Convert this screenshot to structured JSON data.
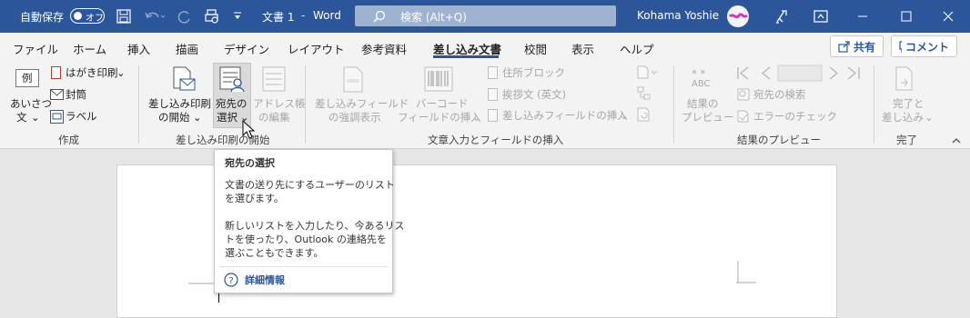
{
  "titlebar": {
    "autosave_label": "自動保存",
    "autosave_state": "オフ",
    "doc_title": "文書 1",
    "dash": "-",
    "app_name": "Word",
    "search_placeholder": "検索 (Alt+Q)",
    "user_name": "Kohama Yoshie"
  },
  "tabs": [
    "ファイル",
    "ホーム",
    "挿入",
    "描画",
    "デザイン",
    "レイアウト",
    "参考資料",
    "差し込み文書",
    "校閲",
    "表示",
    "ヘルプ"
  ],
  "share": {
    "label": "共有"
  },
  "comment": {
    "label": "コメント"
  },
  "ribbon": {
    "create": {
      "greeting_top": "例",
      "greeting_line1": "あいさつ",
      "greeting_line2": "文",
      "postcard": "はがき印刷",
      "envelope": "封筒",
      "label": "ラベル",
      "group": "作成"
    },
    "start": {
      "start_line1": "差し込み印刷",
      "start_line2": "の開始",
      "select_line1": "宛先の",
      "select_line2": "選択",
      "edit_line1": "アドレス帳",
      "edit_line2": "の編集",
      "group": "差し込み印刷の開始"
    },
    "insert": {
      "highlight_line1": "差し込みフィールド",
      "highlight_line2": "の強調表示",
      "barcode_line1": "バーコード",
      "barcode_line2": "フィールドの挿入",
      "address_block": "住所ブロック",
      "greeting_line": "挨拶文 (英文)",
      "insert_field": "差し込みフィールドの挿入",
      "group": "文章入力とフィールドの挿入"
    },
    "preview": {
      "abc": "ABC",
      "preview_line1": "結果の",
      "preview_line2": "プレビュー",
      "find_recipient": "宛先の検索",
      "check_errors": "エラーのチェック",
      "group": "結果のプレビュー"
    },
    "finish": {
      "finish_line1": "完了と",
      "finish_line2": "差し込み",
      "group": "完了"
    }
  },
  "tooltip": {
    "title": "宛先の選択",
    "p1_line1": "文書の送り先にするユーザーのリスト",
    "p1_line2": "を選びます。",
    "p2_line1": "新しいリストを入力したり、今あるリス",
    "p2_line2": "トを使ったり、Outlook の連絡先を",
    "p2_line3": "選ぶこともできます。",
    "more_info": "詳細情報"
  },
  "colors": {
    "titlebar": "#2b579a",
    "ribbon": "#f3f3f3",
    "accent": "#2b579a"
  }
}
